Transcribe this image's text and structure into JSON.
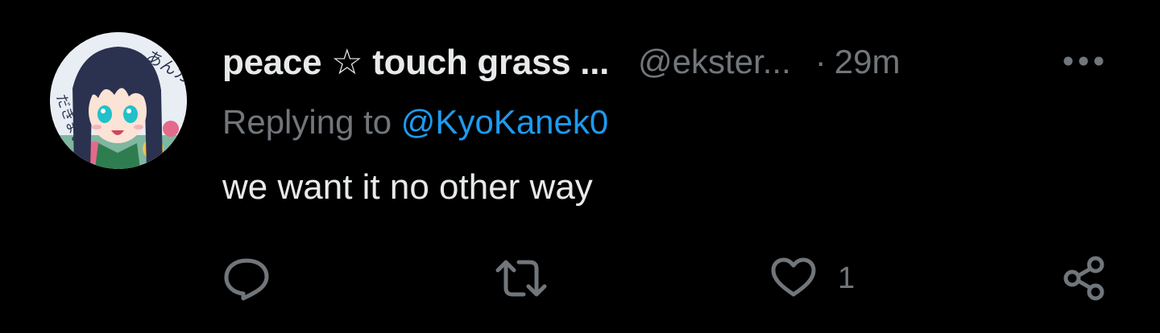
{
  "tweet": {
    "author": {
      "display_name": "peace ☆ touch grass ...",
      "handle": "@ekster...",
      "avatar_text_top": "あんガル",
      "avatar_text_side": "だきまいすき"
    },
    "separator": "·",
    "time": "29m",
    "replying_prefix": "Replying to ",
    "replying_handle": "@KyoKanek0",
    "text": "we want it no other way",
    "actions": {
      "reply_icon": "reply-bubble-icon",
      "retweet_icon": "retweet-icon",
      "like_icon": "heart-icon",
      "like_count": "1",
      "share_icon": "share-icon",
      "more_icon": "more-dots-icon"
    }
  },
  "colors": {
    "background": "#000000",
    "primary_text": "#e7e9ea",
    "secondary_text": "#71767b",
    "link": "#1d9bf0"
  }
}
